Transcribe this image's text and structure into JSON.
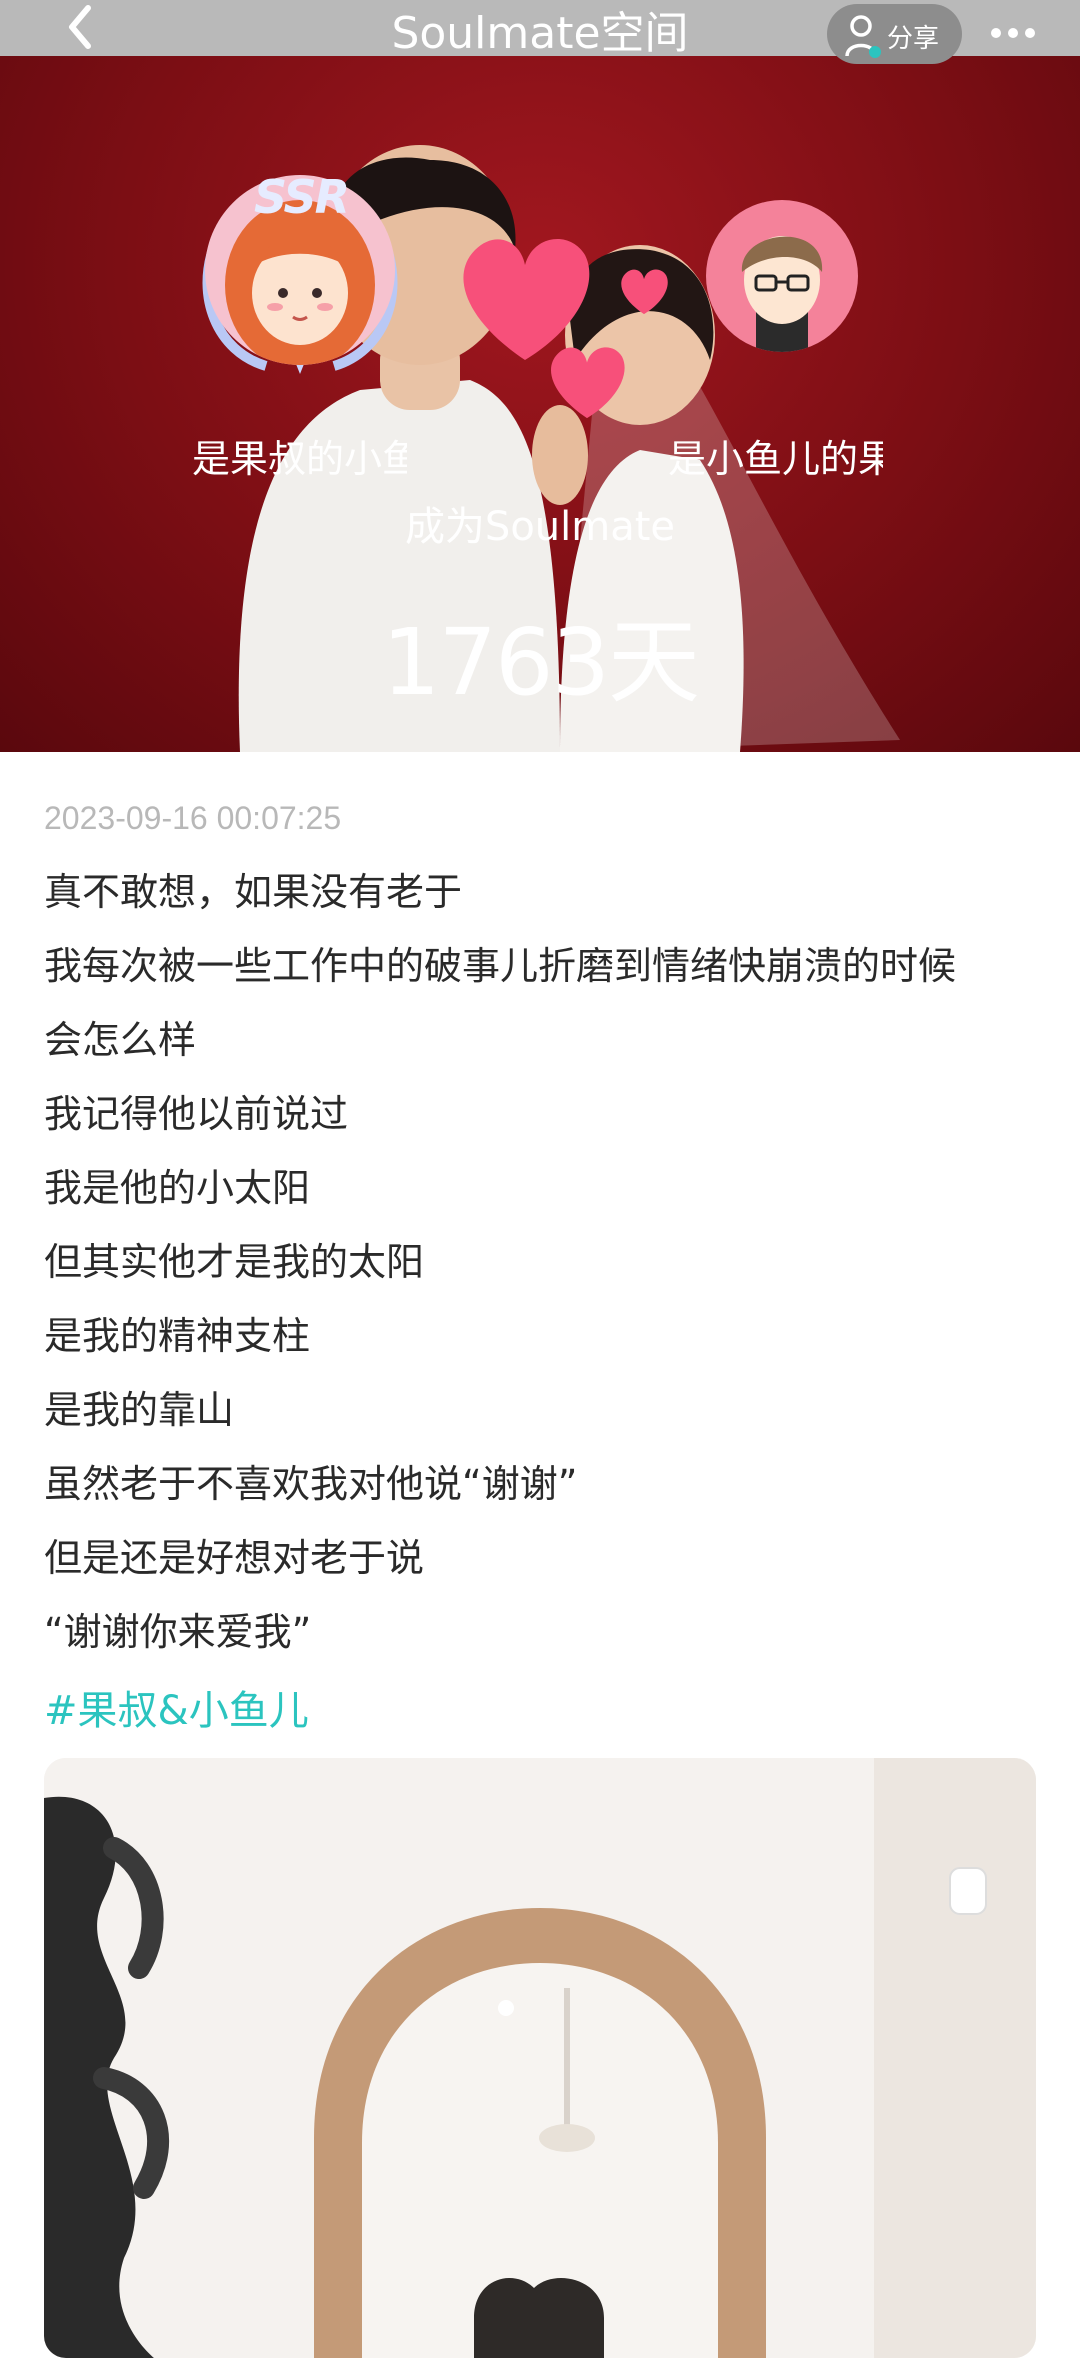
{
  "navbar": {
    "title": "Soulmate空间",
    "back_icon": "chevron-left-icon",
    "share_label": "分享",
    "share_icon": "person-icon",
    "more_icon": "more-dots-icon"
  },
  "hero": {
    "left_badge": "SSR",
    "left_name": "是果叔的小鱼",
    "right_name": "是小鱼儿的果",
    "became_text": "成为Soulmate",
    "days_text": "1763天",
    "accent_color": "#7c0e14",
    "heart_color": "#f7507a"
  },
  "post": {
    "timestamp": "2023-09-16 00:07:25",
    "lines": [
      "真不敢想，如果没有老于",
      "我每次被一些工作中的破事儿折磨到情绪快崩溃的时候",
      "会怎么样",
      "我记得他以前说过",
      "我是他的小太阳",
      "但其实他才是我的太阳",
      "是我的精神支柱",
      "是我的靠山",
      "虽然老于不喜欢我对他说“谢谢”",
      "但是还是好想对老于说",
      "“谢谢你来爱我”"
    ],
    "hashtag": "#果叔&小鱼儿",
    "hashtag_color": "#2bc4bf"
  }
}
